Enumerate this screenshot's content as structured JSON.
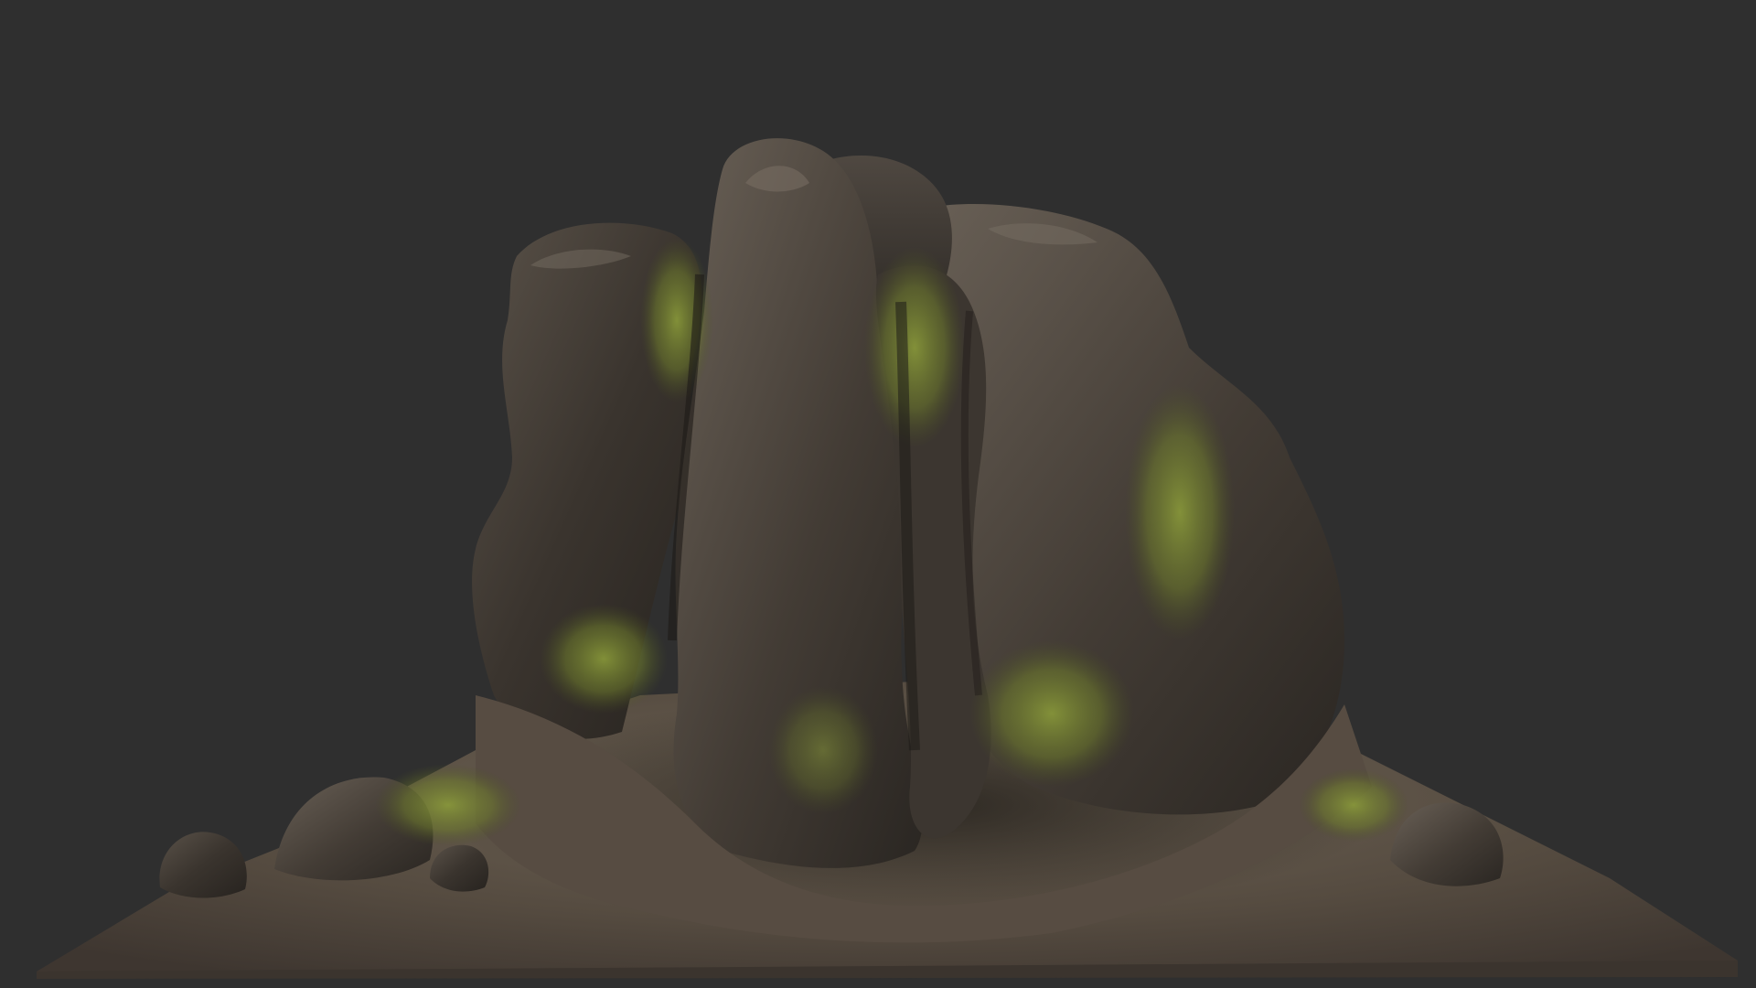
{
  "viewport": {
    "background_color": "#2f2f2f"
  },
  "model": {
    "subject": "rock-formation",
    "colors": {
      "rock_dark": "#2e2a26",
      "rock_mid": "#4a433c",
      "rock_light": "#6e655b",
      "moss": "#6f7d2c",
      "moss_light": "#8a9a3a",
      "ground": "#5b5145",
      "ground_light": "#7a6e60"
    }
  }
}
